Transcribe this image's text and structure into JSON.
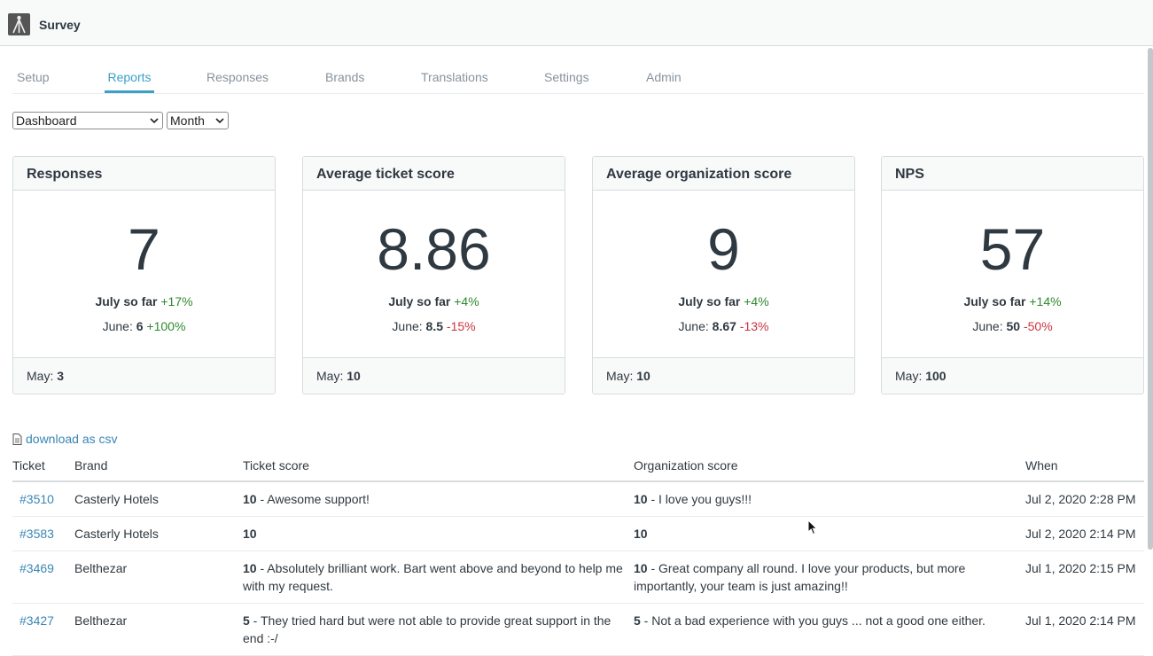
{
  "app": {
    "title": "Survey",
    "logo_icon": "tripod-icon"
  },
  "tabs": [
    {
      "label": "Setup",
      "active": false
    },
    {
      "label": "Reports",
      "active": true
    },
    {
      "label": "Responses",
      "active": false
    },
    {
      "label": "Brands",
      "active": false
    },
    {
      "label": "Translations",
      "active": false
    },
    {
      "label": "Settings",
      "active": false
    },
    {
      "label": "Admin",
      "active": false
    }
  ],
  "filters": {
    "report": "Dashboard",
    "period": "Month"
  },
  "cards": [
    {
      "title": "Responses",
      "value": "7",
      "current_label": "July so far",
      "current_change": "+17%",
      "prev_label": "June:",
      "prev_value": "6",
      "prev_change": "+100%",
      "foot_label": "May:",
      "foot_value": "3"
    },
    {
      "title": "Average ticket score",
      "value": "8.86",
      "current_label": "July so far",
      "current_change": "+4%",
      "prev_label": "June:",
      "prev_value": "8.5",
      "prev_change": "-15%",
      "foot_label": "May:",
      "foot_value": "10"
    },
    {
      "title": "Average organization score",
      "value": "9",
      "current_label": "July so far",
      "current_change": "+4%",
      "prev_label": "June:",
      "prev_value": "8.67",
      "prev_change": "-13%",
      "foot_label": "May:",
      "foot_value": "10"
    },
    {
      "title": "NPS",
      "value": "57",
      "current_label": "July so far",
      "current_change": "+14%",
      "prev_label": "June:",
      "prev_value": "50",
      "prev_change": "-50%",
      "foot_label": "May:",
      "foot_value": "100"
    }
  ],
  "download": {
    "label": "download as csv",
    "icon": "document-icon"
  },
  "table": {
    "headers": [
      "Ticket",
      "Brand",
      "Ticket score",
      "Organization score",
      "When"
    ],
    "rows": [
      {
        "ticket": "#3510",
        "brand": "Casterly Hotels",
        "ticket_score": "10",
        "ticket_comment": " - Awesome support!",
        "org_score": "10",
        "org_comment": " - I love you guys!!!",
        "when": "Jul 2, 2020 2:28 PM"
      },
      {
        "ticket": "#3583",
        "brand": "Casterly Hotels",
        "ticket_score": "10",
        "ticket_comment": "",
        "org_score": "10",
        "org_comment": "",
        "when": "Jul 2, 2020 2:14 PM"
      },
      {
        "ticket": "#3469",
        "brand": "Belthezar",
        "ticket_score": "10",
        "ticket_comment": " - Absolutely brilliant work. Bart went above and beyond to help me with my request.",
        "org_score": "10",
        "org_comment": " - Great company all round. I love your products, but more importantly, your team is just amazing!!",
        "when": "Jul 1, 2020 2:15 PM"
      },
      {
        "ticket": "#3427",
        "brand": "Belthezar",
        "ticket_score": "5",
        "ticket_comment": " - They tried hard but were not able to provide great support in the end :-/",
        "org_score": "5",
        "org_comment": " - Not a bad experience with you guys ... not a good one either.",
        "when": "Jul 1, 2020 2:14 PM"
      }
    ]
  },
  "colors": {
    "accent": "#3aa0c8",
    "positive": "#2e8a2e",
    "negative": "#cc3340",
    "link": "#3a86b4"
  }
}
